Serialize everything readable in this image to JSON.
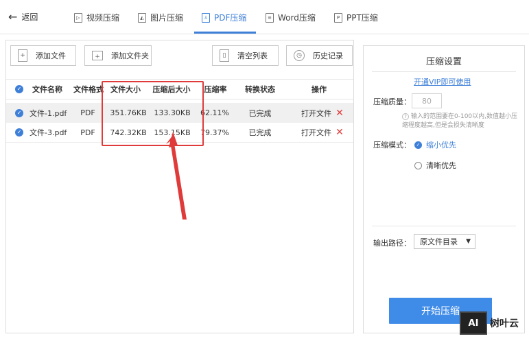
{
  "nav": {
    "back": "返回",
    "tabs": [
      {
        "label": "视频压缩",
        "icon": "video-icon"
      },
      {
        "label": "图片压缩",
        "icon": "image-icon"
      },
      {
        "label": "PDF压缩",
        "icon": "pdf-icon"
      },
      {
        "label": "Word压缩",
        "icon": "word-icon"
      },
      {
        "label": "PPT压缩",
        "icon": "ppt-icon"
      }
    ]
  },
  "toolbar": {
    "add_file": "添加文件",
    "add_folder": "添加文件夹",
    "clear_list": "清空列表",
    "history": "历史记录"
  },
  "table": {
    "headers": [
      "文件名称",
      "文件格式",
      "文件大小",
      "压缩后大小",
      "压缩率",
      "转换状态",
      "操作"
    ],
    "rows": [
      {
        "name": "文件-1.pdf",
        "format": "PDF",
        "size": "351.76KB",
        "compressed": "133.30KB",
        "rate": "62.11%",
        "status": "已完成",
        "action": "打开文件"
      },
      {
        "name": "文件-3.pdf",
        "format": "PDF",
        "size": "742.32KB",
        "compressed": "153.15KB",
        "rate": "79.37%",
        "status": "已完成",
        "action": "打开文件"
      }
    ]
  },
  "settings": {
    "title": "压缩设置",
    "vip_link": "开通VIP即可使用",
    "quality_label": "压缩质量：",
    "quality_value": "80",
    "hint": "输入的范围要在0-100以内,数值越小压缩程度越高,但是会损失清晰度",
    "mode_label": "压缩模式：",
    "mode_options": [
      "缩小优先",
      "清晰优先"
    ],
    "output_label": "输出路径：",
    "output_value": "原文件目录",
    "start_button": "开始压缩"
  },
  "watermark": {
    "logo": "AI",
    "text": "树叶云"
  },
  "colors": {
    "accent": "#3e7fd8",
    "highlight": "#e03b3b",
    "start_button": "#3f8be8"
  }
}
